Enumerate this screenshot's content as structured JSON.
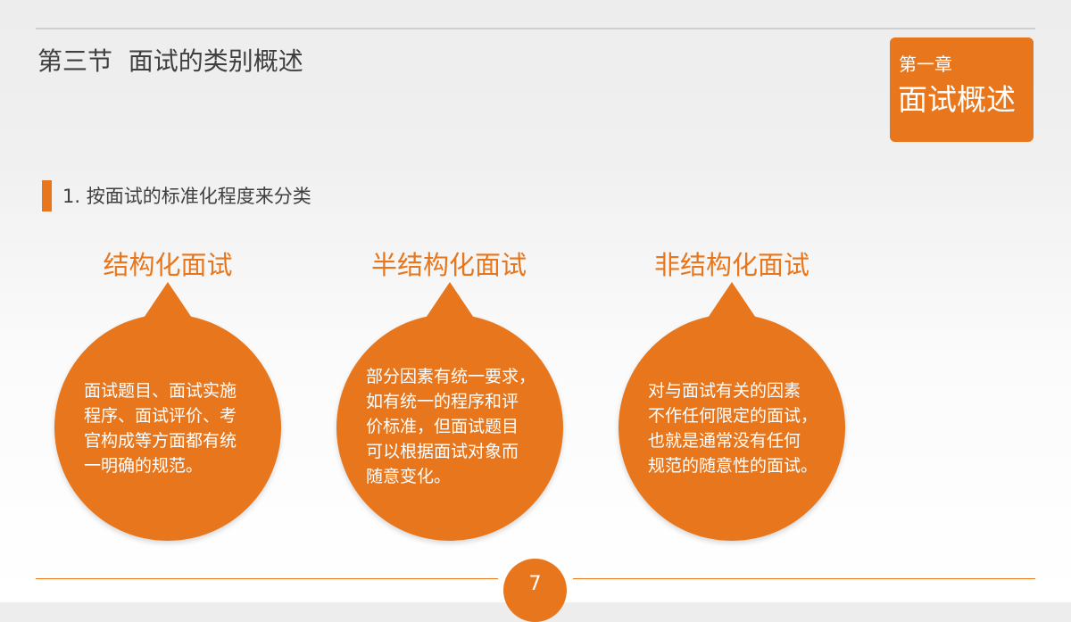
{
  "header": {
    "section_title": "第三节  面试的类别概述"
  },
  "chapter": {
    "label": "第一章",
    "title": "面试概述"
  },
  "subheading": "1. 按面试的标准化程度来分类",
  "columns": [
    {
      "title": "结构化面试",
      "lines": [
        "面试题目、面试实施",
        "程序、面试评价、考",
        "官构成等方面都有统",
        "一明确的规范。"
      ]
    },
    {
      "title": "半结构化面试",
      "lines": [
        "部分因素有统一要求，",
        "如有统一的程序和评",
        "价标准，但面试题目",
        "可以根据面试对象而",
        "随意变化。"
      ]
    },
    {
      "title": "非结构化面试",
      "lines": [
        "对与面试有关的因素",
        "不作任何限定的面试，",
        "也就是通常没有任何",
        "规范的随意性的面试。"
      ]
    }
  ],
  "footer": {
    "page_number": "7"
  },
  "colors": {
    "accent": "#e8761c",
    "text": "#3f3f3f"
  }
}
